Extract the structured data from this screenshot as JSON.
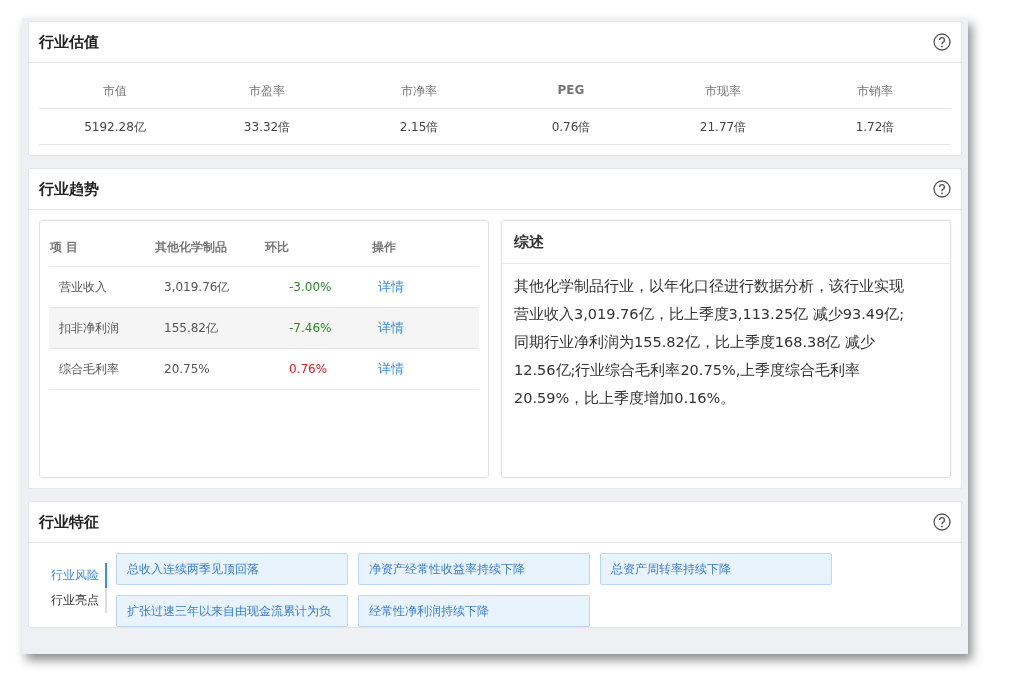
{
  "valuation": {
    "title": "行业估值",
    "columns": [
      "市值",
      "市盈率",
      "市净率",
      "PEG",
      "市现率",
      "市销率"
    ],
    "values": [
      "5192.28亿",
      "33.32倍",
      "2.15倍",
      "0.76倍",
      "21.77倍",
      "1.72倍"
    ]
  },
  "trend": {
    "title": "行业趋势",
    "table": {
      "columns": [
        "项 目",
        "其他化学制品",
        "环比",
        "操作"
      ],
      "rows": [
        {
          "item": "营业收入",
          "value": "3,019.76亿",
          "change": "-3.00%",
          "color": "#2a8a2a",
          "action": "详情"
        },
        {
          "item": "扣非净利润",
          "value": "155.82亿",
          "change": "-7.46%",
          "color": "#2a8a2a",
          "action": "详情"
        },
        {
          "item": "综合毛利率",
          "value": "20.75%",
          "change": "0.76%",
          "color": "#e02020",
          "action": "详情"
        }
      ]
    },
    "summary": {
      "title": "综述",
      "text": "其他化学制品行业，以年化口径进行数据分析，该行业实现营业收入3,019.76亿，比上季度3,113.25亿 减少93.49亿;同期行业净利润为155.82亿，比上季度168.38亿 减少12.56亿;行业综合毛利率20.75%,上季度综合毛利率20.59%，比上季度增加0.16%。"
    }
  },
  "features": {
    "title": "行业特征",
    "tabs": [
      {
        "label": "行业风险",
        "selected": true
      },
      {
        "label": "行业亮点",
        "selected": false
      }
    ],
    "tags": [
      "总收入连续两季见顶回落",
      "净资产经常性收益率持续下降",
      "总资产周转率持续下降",
      "扩张过速三年以来自由现金流累计为负",
      "经常性净利润持续下降"
    ]
  }
}
